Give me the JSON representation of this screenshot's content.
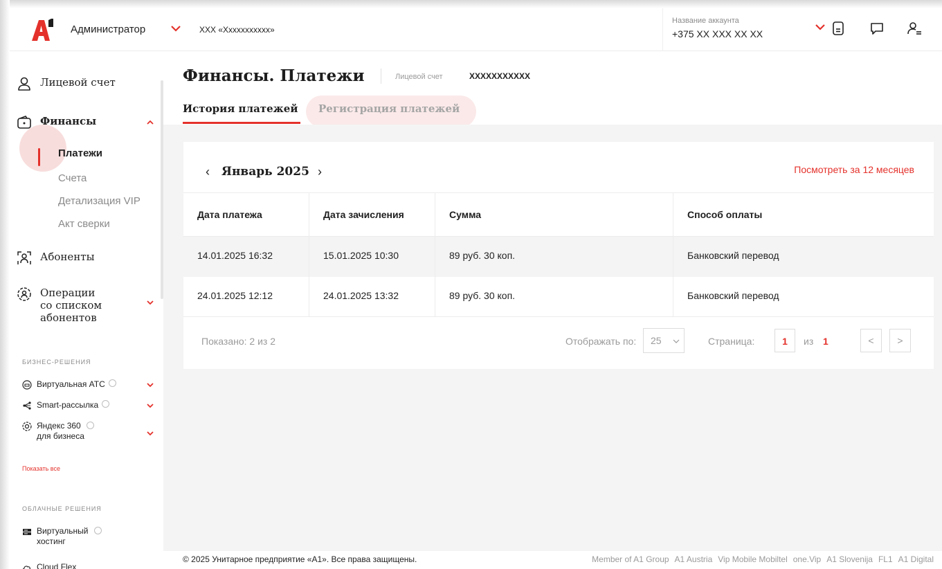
{
  "header": {
    "role": "Администратор",
    "company": "ХХХ «Ххххххххххх»",
    "account_name_label": "Название аккаунта",
    "account_phone": "+375 XX XXX XX XX",
    "icons": [
      "document-icon",
      "chat-icon",
      "user-menu-icon"
    ]
  },
  "sidebar": {
    "personal_account": "Лицевой счет",
    "finance": "Финансы",
    "finance_items": [
      "Платежи",
      "Счета",
      "Детализация VIP",
      "Акт сверки"
    ],
    "subscribers": "Абоненты",
    "operations_line1": "Операции",
    "operations_line2": "со списком",
    "operations_line3": "абонентов",
    "business_title": "БИЗНЕС-РЕШЕНИЯ",
    "business_items": [
      "Виртуальная АТС",
      "Smart-рассылка",
      "Яндекс 360",
      "для бизнеса"
    ],
    "show_all": "Показать все",
    "cloud_title": "ОБЛАЧНЫЕ РЕШЕНИЯ",
    "cloud_items": [
      "Виртуальный",
      "хостинг",
      "Cloud Flex"
    ]
  },
  "main": {
    "title": "Финансы. Платежи",
    "account_label": "Лицевой счет",
    "account_number": "XXXXXXXXXXX",
    "tabs": [
      "История платежей",
      "Регистрация платежей"
    ],
    "month": "Январь 2025",
    "prev_arrow": "‹",
    "next_arrow": "›",
    "view_12_months": "Посмотреть за 12 месяцев",
    "columns": [
      "Дата платежа",
      "Дата зачисления",
      "Сумма",
      "Способ оплаты"
    ],
    "rows": [
      {
        "payment_date": "14.01.2025 16:32",
        "credit_date": "15.01.2025 10:30",
        "amount": "89 руб. 30 коп.",
        "method": "Банковский перевод"
      },
      {
        "payment_date": "24.01.2025 12:12",
        "credit_date": "24.01.2025 13:32",
        "amount": "89 руб. 30 коп.",
        "method": "Банковский перевод"
      }
    ],
    "shown": "Показано: 2 из 2",
    "per_page_label": "Отображать по:",
    "per_page_value": "25",
    "page_label": "Страница:",
    "page_value": "1",
    "of_label": "из",
    "total_pages": "1",
    "pager_prev": "<",
    "pager_next": ">"
  },
  "footer": {
    "copyright": "© 2025 Унитарное предприятие «А1». Все права защищены.",
    "links": [
      "Member of A1 Group",
      "A1 Austria",
      "Vip Mobile Mobiltel",
      "one.Vip",
      "A1 Slovenija",
      "FL1",
      "A1 Digital"
    ]
  },
  "colors": {
    "accent": "#e4312b",
    "muted": "#9a9a9a",
    "background": "#f4f4f4"
  }
}
